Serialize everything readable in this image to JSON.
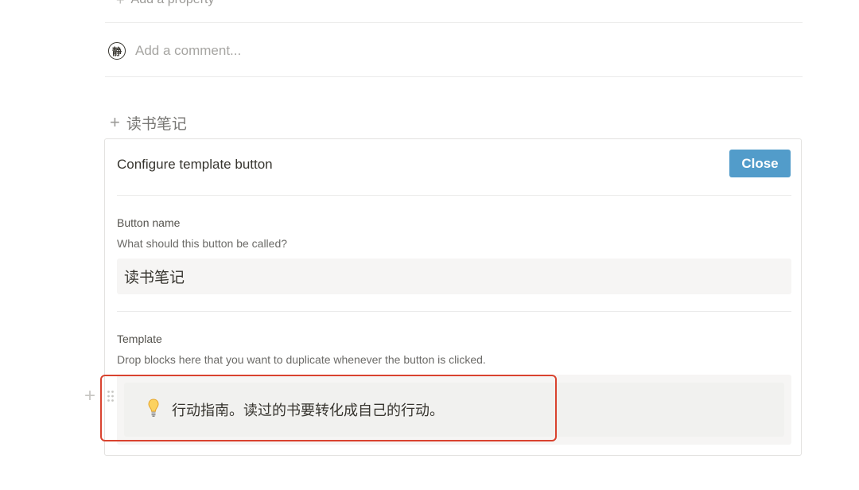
{
  "properties": {
    "add_property_label": "Add a property"
  },
  "comment": {
    "avatar_char": "静",
    "placeholder": "Add a comment..."
  },
  "template_button": {
    "label": "读书笔记"
  },
  "config": {
    "title": "Configure template button",
    "close_label": "Close",
    "accent_color": "#529cca",
    "button_name": {
      "label": "Button name",
      "help": "What should this button be called?",
      "value": "读书笔记"
    },
    "template": {
      "label": "Template",
      "help": "Drop blocks here that you want to duplicate whenever the button is clicked.",
      "callout_icon": "lightbulb-icon",
      "callout_text": "行动指南。读过的书要转化成自己的行动。"
    }
  },
  "annotation": {
    "highlight_color": "#d9432f"
  }
}
